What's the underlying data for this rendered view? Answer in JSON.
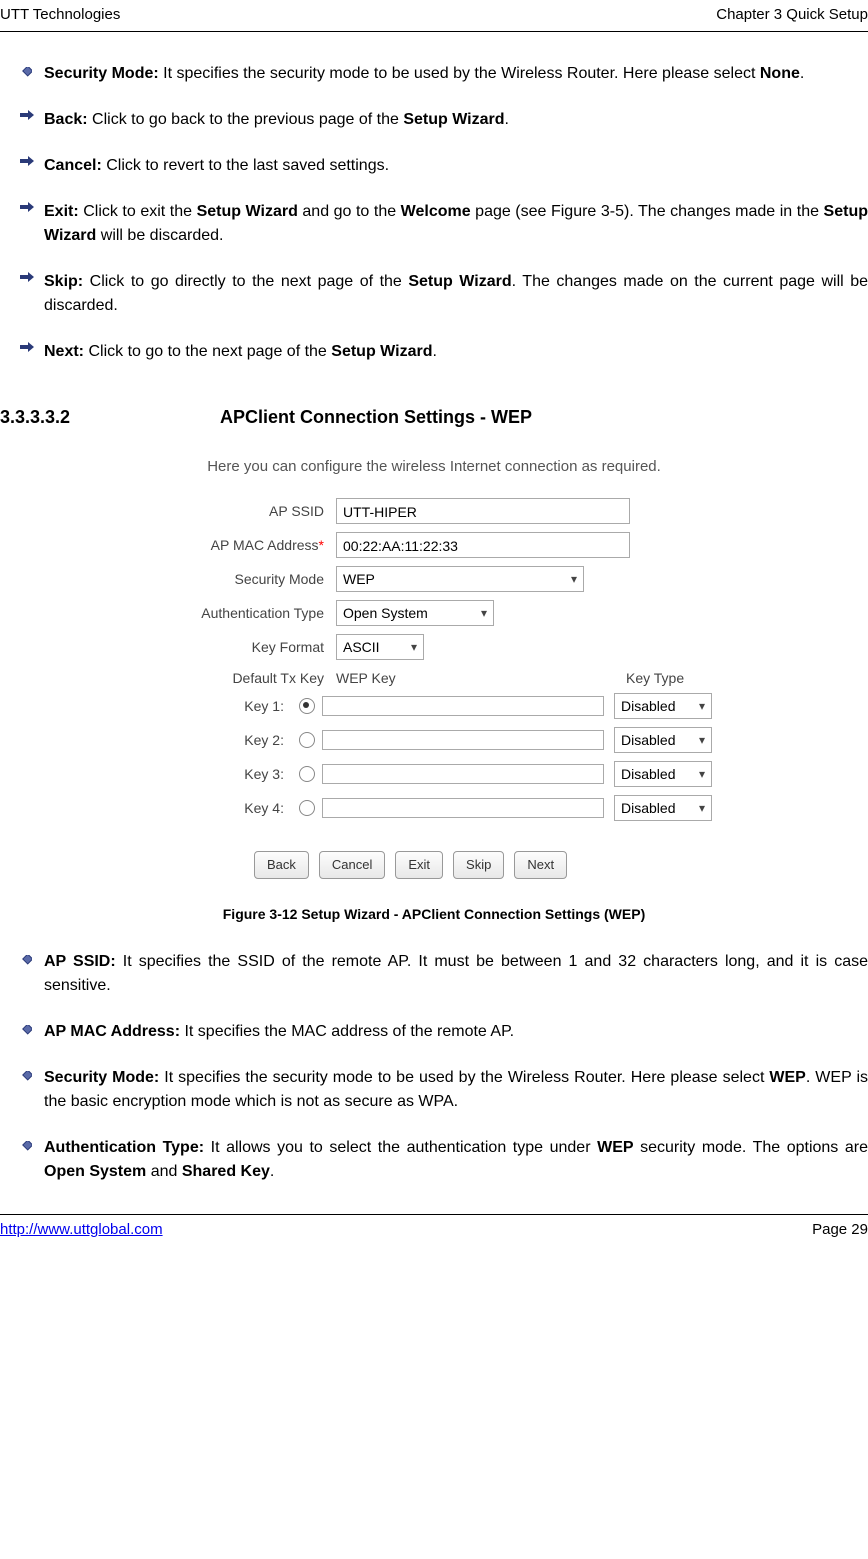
{
  "header": {
    "left": "UTT Technologies",
    "right": "Chapter 3 Quick Setup"
  },
  "top_bullets": [
    {
      "type": "diamond",
      "bold": "Security Mode: ",
      "rest": "It specifies the security mode to be used by the Wireless Router. Here please select ",
      "bold2": "None",
      "tail": "."
    },
    {
      "type": "arrow",
      "bold": "Back: ",
      "rest": "Click to go back to the previous page of the ",
      "bold2": "Setup Wizard",
      "tail": "."
    },
    {
      "type": "arrow",
      "bold": "Cancel: ",
      "rest": "Click to revert to the last saved settings.",
      "bold2": "",
      "tail": ""
    },
    {
      "type": "arrow",
      "bold": "Exit: ",
      "rest": "Click to exit the ",
      "bold2": "Setup Wizard",
      "mid": " and go to the ",
      "bold3": "Welcome",
      "tail": " page (see Figure 3-5). The changes made in the ",
      "bold4": "Setup Wizard",
      "tail2": " will be discarded."
    },
    {
      "type": "arrow",
      "bold": "Skip: ",
      "rest": "Click to go directly to the next page of the ",
      "bold2": "Setup Wizard",
      "tail": ". The changes made on the current page will be discarded."
    },
    {
      "type": "arrow",
      "bold": "Next: ",
      "rest": "Click to go to the next page of the ",
      "bold2": "Setup Wizard",
      "tail": "."
    }
  ],
  "section": {
    "num": "3.3.3.3.2",
    "title": "APClient Connection Settings - WEP"
  },
  "figure": {
    "intro": "Here you can configure the wireless Internet connection as required.",
    "labels": {
      "ap_ssid": "AP SSID",
      "ap_mac": "AP MAC Address",
      "sec_mode": "Security Mode",
      "auth_type": "Authentication Type",
      "key_format": "Key Format",
      "default_tx": "Default Tx Key",
      "wep_key": "WEP Key",
      "key_type": "Key Type",
      "key1": "Key 1:",
      "key2": "Key 2:",
      "key3": "Key 3:",
      "key4": "Key 4:"
    },
    "values": {
      "ap_ssid": "UTT-HIPER",
      "ap_mac": "00:22:AA:11:22:33",
      "sec_mode": "WEP",
      "auth_type": "Open System",
      "key_format": "ASCII",
      "key_type": "Disabled"
    },
    "buttons": {
      "back": "Back",
      "cancel": "Cancel",
      "exit": "Exit",
      "skip": "Skip",
      "next": "Next"
    },
    "caption": "Figure 3-12 Setup Wizard - APClient Connection Settings (WEP)"
  },
  "bottom_bullets": [
    {
      "bold": "AP SSID: ",
      "rest": "It specifies the SSID of the remote AP. It must be between 1 and 32 characters long, and it is case sensitive."
    },
    {
      "bold": "AP MAC Address: ",
      "rest": "It specifies the MAC address of the remote AP."
    },
    {
      "bold": "Security Mode: ",
      "rest": "It specifies the security mode to be used by the Wireless Router. Here please select ",
      "bold2": "WEP",
      "tail": ". WEP is the basic encryption mode which is not as secure as WPA."
    },
    {
      "bold": "Authentication Type: ",
      "rest": "It allows you to select the authentication type under ",
      "bold2": "WEP",
      "tail": " security mode. The options are ",
      "bold3": "Open System",
      "mid": " and ",
      "bold4": "Shared Key",
      "tail2": "."
    }
  ],
  "footer": {
    "url": "http://www.uttglobal.com",
    "page": "Page 29"
  }
}
